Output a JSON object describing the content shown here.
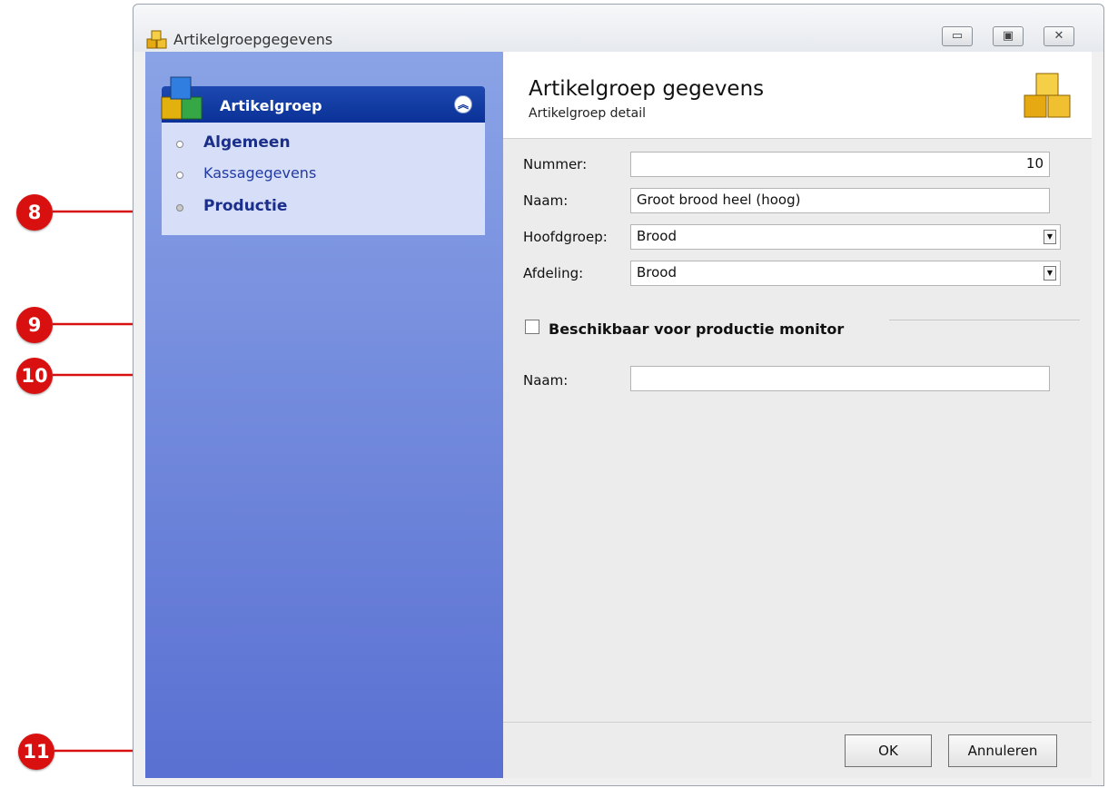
{
  "window": {
    "title": "Artikelgroepgegevens",
    "controls": {
      "minimize": "▭",
      "maximize": "▣",
      "close": "✕"
    }
  },
  "sidebar": {
    "panel_title": "Artikelgroep",
    "collapse_glyph": "︽",
    "items": [
      {
        "label": "Algemeen",
        "active": false
      },
      {
        "label": "Kassagegevens",
        "active": false
      },
      {
        "label": "Productie",
        "active": true
      }
    ]
  },
  "header": {
    "title": "Artikelgroep gegevens",
    "subtitle": "Artikelgroep detail"
  },
  "form": {
    "nummer": {
      "label": "Nummer:",
      "value": "10"
    },
    "naam": {
      "label": "Naam:",
      "value": "Groot brood heel (hoog)"
    },
    "hoofdgroep": {
      "label": "Hoofdgroep:",
      "value": "Brood"
    },
    "afdeling": {
      "label": "Afdeling:",
      "value": "Brood"
    }
  },
  "production": {
    "checkbox_label": "Beschikbaar voor productie monitor",
    "checked": false,
    "naam": {
      "label": "Naam:",
      "value": ""
    }
  },
  "buttons": {
    "ok": "OK",
    "cancel": "Annuleren"
  },
  "callouts": [
    "8",
    "9",
    "10",
    "11"
  ],
  "colors": {
    "callout": "#d81010",
    "sidebar_top": "#8aa3e6",
    "sidebar_bottom": "#5a70d2",
    "panel_head": "#0a3197"
  }
}
